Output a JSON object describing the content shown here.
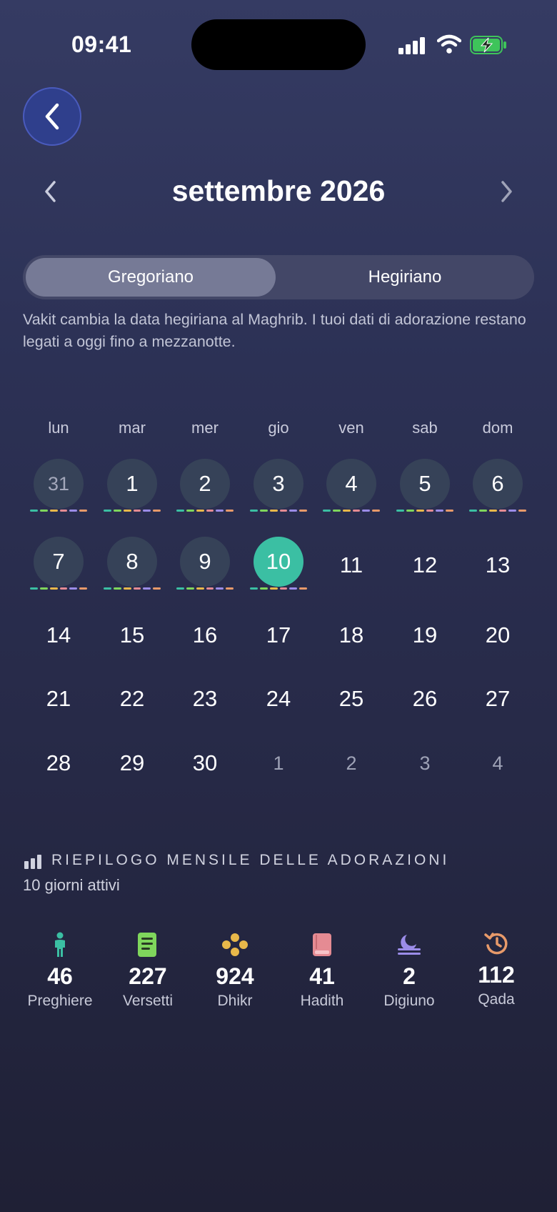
{
  "status_bar": {
    "time": "09:41"
  },
  "header": {
    "month_title": "settembre 2026"
  },
  "segmented": {
    "gregorian_label": "Gregoriano",
    "hijri_label": "Hegiriano",
    "selected": "Gregoriano"
  },
  "note": "Vakit cambia la data hegiriana al Maghrib. I tuoi dati di adorazione restano legati a oggi fino a mezzanotte.",
  "weekdays": [
    "lun",
    "mar",
    "mer",
    "gio",
    "ven",
    "sab",
    "dom"
  ],
  "weeks": [
    [
      {
        "n": "31",
        "state": "other-active"
      },
      {
        "n": "1",
        "state": "active"
      },
      {
        "n": "2",
        "state": "active"
      },
      {
        "n": "3",
        "state": "active"
      },
      {
        "n": "4",
        "state": "active"
      },
      {
        "n": "5",
        "state": "active"
      },
      {
        "n": "6",
        "state": "active"
      }
    ],
    [
      {
        "n": "7",
        "state": "active"
      },
      {
        "n": "8",
        "state": "active"
      },
      {
        "n": "9",
        "state": "active"
      },
      {
        "n": "10",
        "state": "today"
      },
      {
        "n": "11",
        "state": "future"
      },
      {
        "n": "12",
        "state": "future"
      },
      {
        "n": "13",
        "state": "future"
      }
    ],
    [
      {
        "n": "14",
        "state": "future"
      },
      {
        "n": "15",
        "state": "future"
      },
      {
        "n": "16",
        "state": "future"
      },
      {
        "n": "17",
        "state": "future"
      },
      {
        "n": "18",
        "state": "future"
      },
      {
        "n": "19",
        "state": "future"
      },
      {
        "n": "20",
        "state": "future"
      }
    ],
    [
      {
        "n": "21",
        "state": "future"
      },
      {
        "n": "22",
        "state": "future"
      },
      {
        "n": "23",
        "state": "future"
      },
      {
        "n": "24",
        "state": "future"
      },
      {
        "n": "25",
        "state": "future"
      },
      {
        "n": "26",
        "state": "future"
      },
      {
        "n": "27",
        "state": "future"
      }
    ],
    [
      {
        "n": "28",
        "state": "future"
      },
      {
        "n": "29",
        "state": "future"
      },
      {
        "n": "30",
        "state": "future"
      },
      {
        "n": "1",
        "state": "next"
      },
      {
        "n": "2",
        "state": "next"
      },
      {
        "n": "3",
        "state": "next"
      },
      {
        "n": "4",
        "state": "next"
      }
    ]
  ],
  "activity_colors": [
    "#3bbfa3",
    "#7fd65c",
    "#e8b84a",
    "#e58b93",
    "#9b8ce8",
    "#e89a6a"
  ],
  "summary": {
    "title": "RIEPILOGO MENSILE DELLE ADORAZIONI",
    "subtitle": "10 giorni attivi",
    "stats": [
      {
        "value": "46",
        "label": "Preghiere",
        "icon": "person-icon",
        "color": "#3bbfa3"
      },
      {
        "value": "227",
        "label": "Versetti",
        "icon": "book-icon",
        "color": "#7fd65c"
      },
      {
        "value": "924",
        "label": "Dhikr",
        "icon": "beads-icon",
        "color": "#e8b84a"
      },
      {
        "value": "41",
        "label": "Hadith",
        "icon": "hadith-book-icon",
        "color": "#e58b93"
      },
      {
        "value": "2",
        "label": "Digiuno",
        "icon": "moon-icon",
        "color": "#9b8ce8"
      },
      {
        "value": "112",
        "label": "Qada",
        "icon": "history-icon",
        "color": "#e89a6a"
      }
    ]
  }
}
